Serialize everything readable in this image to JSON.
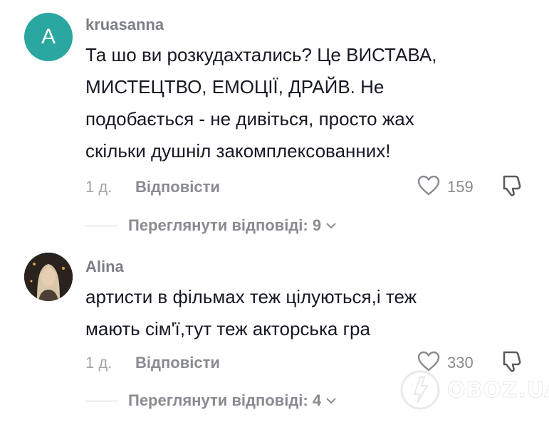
{
  "comments": [
    {
      "avatar_letter": "A",
      "username": "kruasanna",
      "text_lines": [
        "Та шо ви розкудахтались? Це ВИСТАВА,",
        "МИСТЕЦТВО, ЕМОЦІЇ, ДРАЙВ. Не",
        "подобається - не дивіться, просто жах",
        "скільки душніл закомплексованних!"
      ],
      "time": "1 д.",
      "reply_label": "Відповісти",
      "likes": "159",
      "view_replies": "Переглянути відповіді: 9"
    },
    {
      "avatar_letter": "",
      "username": "Alina",
      "text_lines": [
        "артисти в фільмах теж цілуються,і теж",
        "мають сім'ї,тут теж акторська гра"
      ],
      "time": "1 д.",
      "reply_label": "Відповісти",
      "likes": "330",
      "view_replies": "Переглянути відповіді: 4"
    }
  ],
  "watermark": {
    "text": "OBOZ.UA"
  },
  "colors": {
    "avatar_bg": "#2aa7a0",
    "text": "#161823",
    "muted": "#8a8b91"
  },
  "icons": {
    "like": "heart-outline-icon",
    "dislike": "thumbs-down-icon",
    "expand": "chevron-down-icon"
  }
}
